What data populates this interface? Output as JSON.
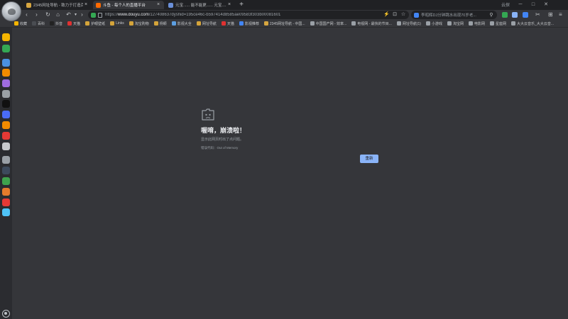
{
  "tabs": [
    {
      "title": "2345网址导航 - 致力于打造百年",
      "active": false,
      "favicon_color": "#d6a640"
    },
    {
      "title": "斗鱼 - 每个人的直播平台",
      "active": true,
      "favicon_color": "#ff6a00"
    },
    {
      "title": "元宝...... 能不能更...... 元宝......能不能更",
      "active": false,
      "favicon_color": "#6a8fd8"
    }
  ],
  "window": {
    "user_label": "云探"
  },
  "toolbar": {
    "url_prefix": "https://",
    "url_host": "www.douyu.com",
    "url_path": "/127408637dyshid=195ce46c-b597414d8585ae09583f303b00081601",
    "search_text": "李昭辉DJ分钟跳水出现70岁老..."
  },
  "bookmarks": [
    {
      "label": "收藏",
      "color": "#f4b400"
    },
    {
      "label": "百科",
      "color": "#4a4d52"
    },
    {
      "label": "抖音",
      "color": "#222222"
    },
    {
      "label": "天猫",
      "color": "#e03131"
    },
    {
      "label": "护眼壁纸",
      "color": "#d4a43a"
    },
    {
      "label": "Links",
      "color": "#d4a43a"
    },
    {
      "label": "淘宝购物",
      "color": "#d4a43a"
    },
    {
      "label": "杨颖",
      "color": "#d4a43a"
    },
    {
      "label": "影视大全",
      "color": "#5c9ee0"
    },
    {
      "label": "网址导航",
      "color": "#d4a43a"
    },
    {
      "label": "天猫",
      "color": "#e03131"
    },
    {
      "label": "影视推荐",
      "color": "#4285f4"
    },
    {
      "label": "2345网址导航 - 中国...",
      "color": "#d6a640"
    },
    {
      "label": "中国国产网 - 效率...",
      "color": "#9aa0a6"
    },
    {
      "label": "电视网 - 最快的节目...",
      "color": "#9aa0a6"
    },
    {
      "label": "网址导航(1)",
      "color": "#9aa0a6"
    },
    {
      "label": "小游戏",
      "color": "#9aa0a6"
    },
    {
      "label": "淘宝网",
      "color": "#9aa0a6"
    },
    {
      "label": "电影网",
      "color": "#9aa0a6"
    },
    {
      "label": "星座网",
      "color": "#9aa0a6"
    },
    {
      "label": "大大云音乐_大大云音...",
      "color": "#9aa0a6"
    }
  ],
  "sidebar": {
    "items": [
      {
        "name": "favorites",
        "color": "#f4b400"
      },
      {
        "name": "wechat",
        "color": "#34a853"
      },
      {
        "name": "qq",
        "color": "#4a90e2"
      },
      {
        "name": "weibo",
        "color": "#f28b00"
      },
      {
        "name": "game",
        "color": "#9f6ce0"
      },
      {
        "name": "assistant",
        "color": "#9aa0a6"
      },
      {
        "name": "douyin",
        "color": "#111111"
      },
      {
        "name": "settings-app",
        "color": "#4a6cf7"
      },
      {
        "name": "feed",
        "color": "#f28b00"
      },
      {
        "name": "mail",
        "color": "#e53935"
      },
      {
        "name": "shop",
        "color": "#c7c9cc"
      },
      {
        "name": "calculator",
        "color": "#9aa0a6"
      },
      {
        "name": "anime",
        "color": "#3d4a5c"
      },
      {
        "name": "game-2",
        "color": "#3fa34d"
      },
      {
        "name": "game-3",
        "color": "#e57b2c"
      },
      {
        "name": "game-4",
        "color": "#e53935"
      },
      {
        "name": "monitor",
        "color": "#4fc3f7"
      }
    ]
  },
  "error": {
    "title": "喔唷，崩溃啦！",
    "description": "显示此网页时出了点问题。",
    "code_label": "错误代码：",
    "code": "Out of Memory",
    "reload_label": "重新"
  }
}
